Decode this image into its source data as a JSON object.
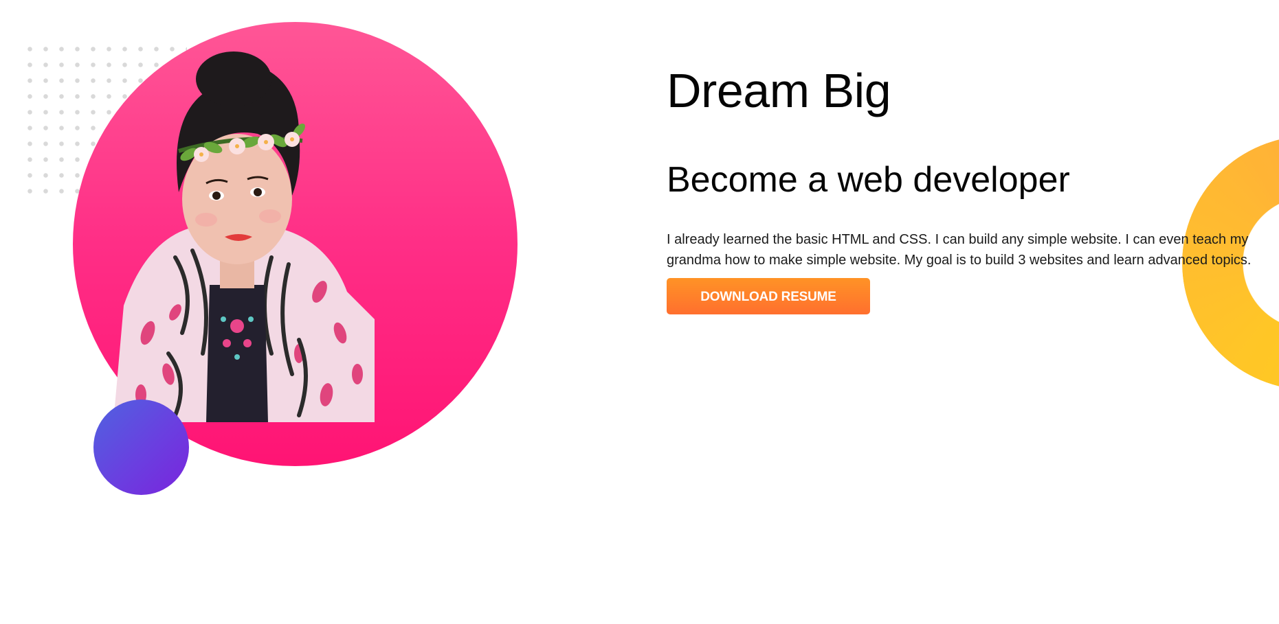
{
  "hero": {
    "title": "Dream Big",
    "subtitle": "Become a web developer",
    "description": "I already learned the basic HTML and CSS. I can build any simple website. I can even teach my grandma how to make simple website. My goal is to build 3 websites and learn advanced topics.",
    "download_button_label": "DOWNLOAD RESUME"
  },
  "colors": {
    "pink_circle": "#ff2e86",
    "purple_circle": "#6a3fe0",
    "ring": "#ffb42a",
    "button": "#ff7f2a"
  }
}
